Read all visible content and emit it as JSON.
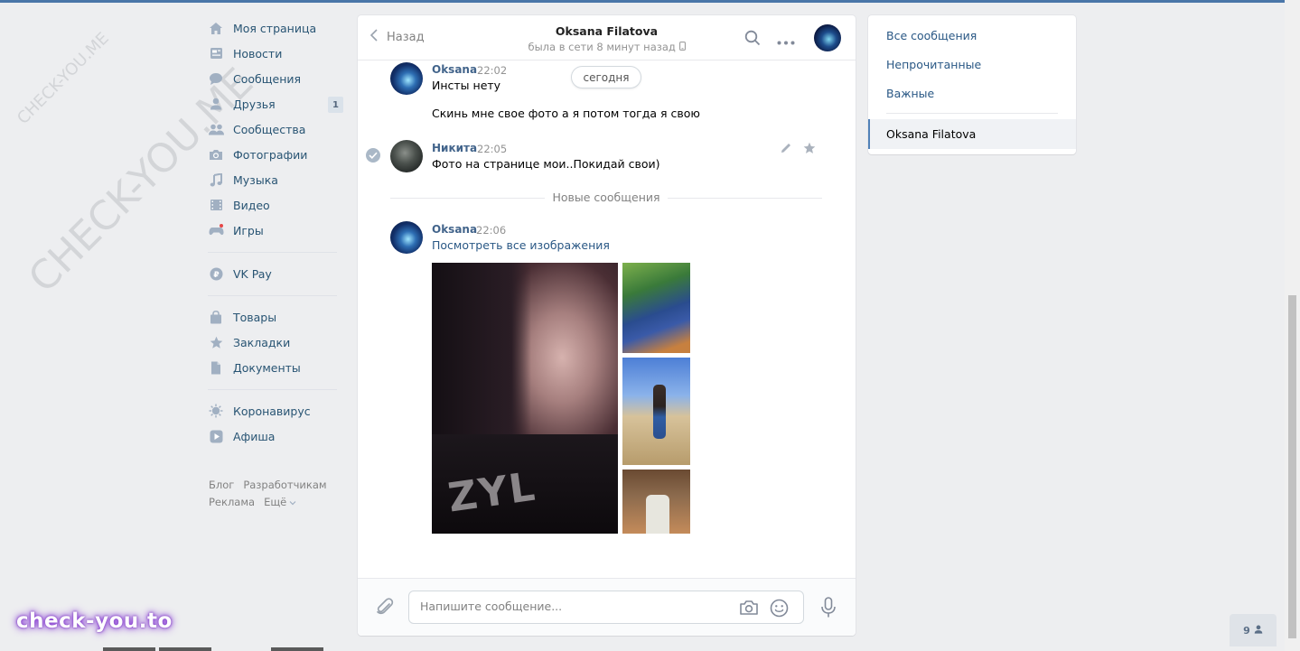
{
  "watermarks": {
    "small": "CHECK-YOU.ME",
    "large": "CHECK-YOU.ME",
    "bottom_logo": "check-you.to"
  },
  "left_nav": {
    "items": [
      {
        "label": "Моя страница",
        "icon": "home-icon"
      },
      {
        "label": "Новости",
        "icon": "news-icon"
      },
      {
        "label": "Сообщения",
        "icon": "messages-icon"
      },
      {
        "label": "Друзья",
        "icon": "friends-icon",
        "count": "1"
      },
      {
        "label": "Сообщества",
        "icon": "communities-icon"
      },
      {
        "label": "Фотографии",
        "icon": "camera-icon"
      },
      {
        "label": "Музыка",
        "icon": "music-icon"
      },
      {
        "label": "Видео",
        "icon": "video-icon"
      },
      {
        "label": "Игры",
        "icon": "games-icon"
      }
    ],
    "pay": {
      "label": "VK Pay",
      "icon": "vkpay-icon"
    },
    "group3": [
      {
        "label": "Товары",
        "icon": "bag-icon"
      },
      {
        "label": "Закладки",
        "icon": "star-icon"
      },
      {
        "label": "Документы",
        "icon": "document-icon"
      }
    ],
    "group4": [
      {
        "label": "Коронавирус",
        "icon": "virus-icon"
      },
      {
        "label": "Афиша",
        "icon": "play-icon"
      }
    ],
    "footer": {
      "blog": "Блог",
      "dev": "Разработчикам",
      "ads": "Реклама",
      "more": "Ещё"
    }
  },
  "chat": {
    "back_label": "Назад",
    "peer_name": "Oksana Filatova",
    "peer_status": "была в сети 8 минут назад",
    "date_pill": "сегодня",
    "new_messages_label": "Новые сообщения",
    "messages": [
      {
        "author": "Oksana",
        "time": "22:02",
        "lines": [
          "Инсты нету",
          "Скинь мне свое фото а я потом тогда я свою"
        ]
      },
      {
        "author": "Никита",
        "time": "22:05",
        "lines": [
          "Фото на странице мои..Покидай свои)"
        ]
      },
      {
        "author": "Oksana",
        "time": "22:06",
        "link": "Посмотреть все изображения"
      }
    ],
    "photo_text": "ZYL",
    "composer_placeholder": "Напишите сообщение..."
  },
  "right_nav": {
    "all": "Все сообщения",
    "unread": "Непрочитанные",
    "important": "Важные",
    "active": "Oksana Filatova"
  },
  "online": {
    "count": "9"
  },
  "colors": {
    "accent": "#4a76a8",
    "link": "#2a5885",
    "author": "#42648b",
    "nav_text": "#285473",
    "bg": "#edeef0"
  }
}
